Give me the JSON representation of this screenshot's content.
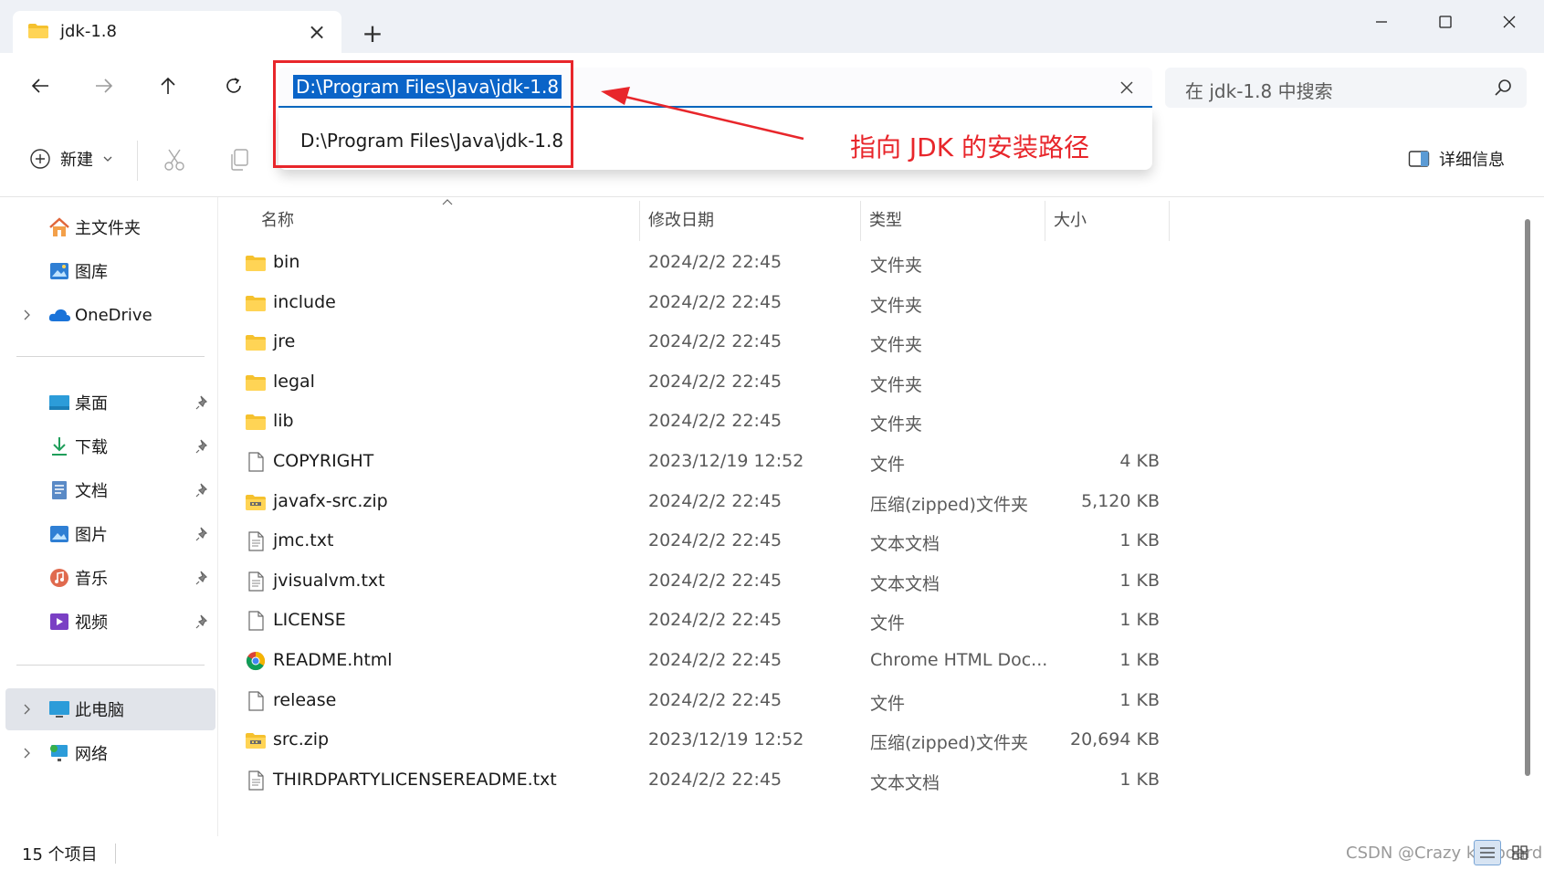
{
  "tab": {
    "title": "jdk-1.8"
  },
  "address": {
    "path": "D:\\Program Files\\Java\\jdk-1.8",
    "suggestion": "D:\\Program Files\\Java\\jdk-1.8"
  },
  "search": {
    "placeholder": "在 jdk-1.8 中搜索"
  },
  "toolbar": {
    "new_label": "新建",
    "details_label": "详细信息"
  },
  "annotation": {
    "text": "指向 JDK 的安装路径",
    "color": "#e8262b"
  },
  "sidebar": {
    "items": [
      {
        "label": "主文件夹"
      },
      {
        "label": "图库"
      },
      {
        "label": "OneDrive"
      },
      {
        "label": "桌面"
      },
      {
        "label": "下载"
      },
      {
        "label": "文档"
      },
      {
        "label": "图片"
      },
      {
        "label": "音乐"
      },
      {
        "label": "视频"
      },
      {
        "label": "此电脑"
      },
      {
        "label": "网络"
      }
    ]
  },
  "columns": {
    "name": "名称",
    "date": "修改日期",
    "type": "类型",
    "size": "大小"
  },
  "files": [
    {
      "name": "bin",
      "date": "2024/2/2 22:45",
      "type": "文件夹",
      "size": "",
      "icon": "folder-icon"
    },
    {
      "name": "include",
      "date": "2024/2/2 22:45",
      "type": "文件夹",
      "size": "",
      "icon": "folder-icon"
    },
    {
      "name": "jre",
      "date": "2024/2/2 22:45",
      "type": "文件夹",
      "size": "",
      "icon": "folder-icon"
    },
    {
      "name": "legal",
      "date": "2024/2/2 22:45",
      "type": "文件夹",
      "size": "",
      "icon": "folder-icon"
    },
    {
      "name": "lib",
      "date": "2024/2/2 22:45",
      "type": "文件夹",
      "size": "",
      "icon": "folder-icon"
    },
    {
      "name": "COPYRIGHT",
      "date": "2023/12/19 12:52",
      "type": "文件",
      "size": "4 KB",
      "icon": "file-icon"
    },
    {
      "name": "javafx-src.zip",
      "date": "2024/2/2 22:45",
      "type": "压缩(zipped)文件夹",
      "size": "5,120 KB",
      "icon": "zip-icon"
    },
    {
      "name": "jmc.txt",
      "date": "2024/2/2 22:45",
      "type": "文本文档",
      "size": "1 KB",
      "icon": "text-file-icon"
    },
    {
      "name": "jvisualvm.txt",
      "date": "2024/2/2 22:45",
      "type": "文本文档",
      "size": "1 KB",
      "icon": "text-file-icon"
    },
    {
      "name": "LICENSE",
      "date": "2024/2/2 22:45",
      "type": "文件",
      "size": "1 KB",
      "icon": "file-icon"
    },
    {
      "name": "README.html",
      "date": "2024/2/2 22:45",
      "type": "Chrome HTML Doc...",
      "size": "1 KB",
      "icon": "chrome-icon"
    },
    {
      "name": "release",
      "date": "2024/2/2 22:45",
      "type": "文件",
      "size": "1 KB",
      "icon": "file-icon"
    },
    {
      "name": "src.zip",
      "date": "2023/12/19 12:52",
      "type": "压缩(zipped)文件夹",
      "size": "20,694 KB",
      "icon": "zip-icon"
    },
    {
      "name": "THIRDPARTYLICENSEREADME.txt",
      "date": "2024/2/2 22:45",
      "type": "文本文档",
      "size": "1 KB",
      "icon": "text-file-icon"
    }
  ],
  "status": {
    "count": "15 个项目"
  },
  "watermark": "CSDN @Crazy keyboard"
}
